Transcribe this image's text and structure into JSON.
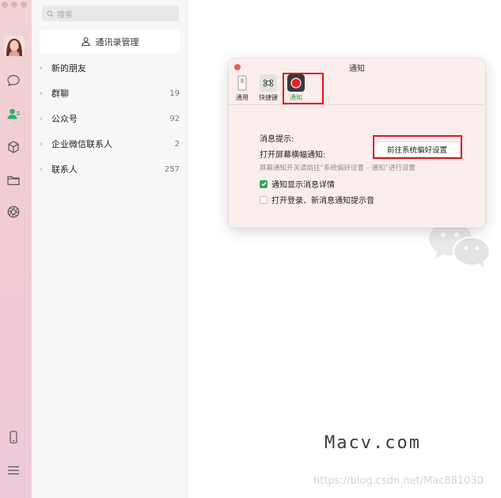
{
  "sidebar": {
    "icons": [
      "chat-icon",
      "contacts-icon",
      "mini-program-cube-icon",
      "folder-icon",
      "moments-aperture-icon",
      "phone-icon",
      "menu-icon"
    ],
    "active_color": "#2aae67"
  },
  "contacts": {
    "search_placeholder": "搜索",
    "manage_button": "通讯录管理",
    "groups": [
      {
        "label": "新的朋友",
        "count": ""
      },
      {
        "label": "群聊",
        "count": "19"
      },
      {
        "label": "公众号",
        "count": "92"
      },
      {
        "label": "企业微信联系人",
        "count": "2"
      },
      {
        "label": "联系人",
        "count": "257"
      }
    ]
  },
  "dialog": {
    "title": "通知",
    "toolbar": [
      {
        "label": "通用",
        "icon": "general-switch-icon"
      },
      {
        "label": "快捷键",
        "icon": "command-key-icon"
      },
      {
        "label": "通知",
        "icon": "notification-record-icon"
      }
    ],
    "section_label": "消息提示:",
    "banner_label": "打开屏幕横幅通知:",
    "pref_button": "前往系统偏好设置",
    "hint": "屏幕通知开关请前往“系统偏好设置 – 通知”进行设置",
    "options": [
      {
        "label": "通知显示消息详情",
        "checked": true
      },
      {
        "label": "打开登录、新消息通知提示音",
        "checked": false
      }
    ],
    "highlight_color": "#e8101a"
  },
  "brand": "Macv.com",
  "watermark": "https://blog.csdn.net/Mac881030"
}
